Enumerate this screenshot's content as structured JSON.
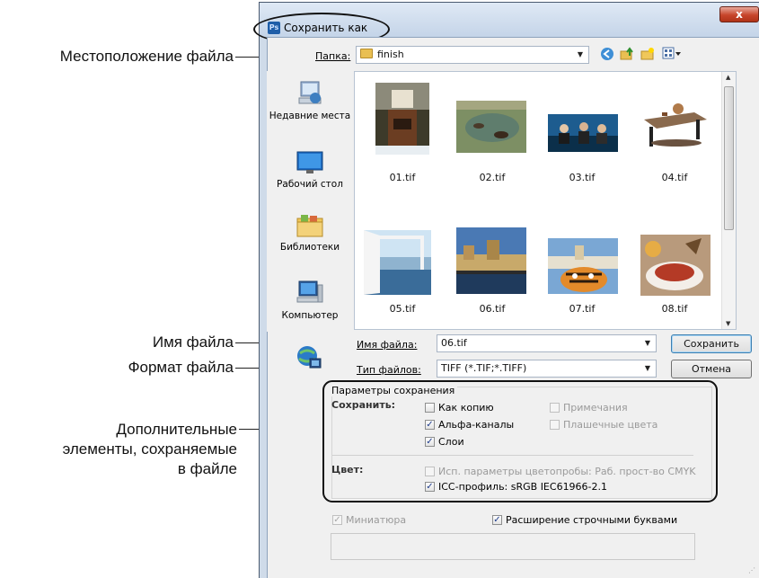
{
  "annotations": {
    "location": "Местоположение файла",
    "filename": "Имя файла",
    "format": "Формат файла",
    "extra_line1": "Дополнительные",
    "extra_line2": "элементы, сохраняемые",
    "extra_line3": "в файле"
  },
  "dialog": {
    "title": "Сохранить как",
    "close": "x",
    "app_icon": "Ps"
  },
  "folder": {
    "label": "Папка:",
    "value": "finish"
  },
  "places": [
    {
      "label": "Недавние места",
      "icon": "recent-places-icon"
    },
    {
      "label": "Рабочий стол",
      "icon": "desktop-icon"
    },
    {
      "label": "Библиотеки",
      "icon": "libraries-icon"
    },
    {
      "label": "Компьютер",
      "icon": "computer-icon"
    }
  ],
  "files": [
    {
      "name": "01.tif"
    },
    {
      "name": "02.tif"
    },
    {
      "name": "03.tif"
    },
    {
      "name": "04.tif"
    },
    {
      "name": "05.tif"
    },
    {
      "name": "06.tif"
    },
    {
      "name": "07.tif"
    },
    {
      "name": "08.tif"
    }
  ],
  "filename": {
    "label": "Имя файла:",
    "value": "06.tif"
  },
  "filetype": {
    "label": "Тип файлов:",
    "value": "TIFF (*.TIF;*.TIFF)"
  },
  "buttons": {
    "save": "Сохранить",
    "cancel": "Отмена"
  },
  "options": {
    "group_title": "Параметры сохранения",
    "save_label": "Сохранить:",
    "as_copy": "Как копию",
    "notes": "Примечания",
    "alpha": "Альфа-каналы",
    "spot": "Плашечные цвета",
    "layers": "Слои",
    "color_label": "Цвет:",
    "proof": "Исп. параметры цветопробы:  Раб. прост-во CMYK",
    "icc": "ICC-профиль:  sRGB IEC61966-2.1"
  },
  "thumbnail": "Миниатюра",
  "lowercase_ext": "Расширение строчными буквами"
}
